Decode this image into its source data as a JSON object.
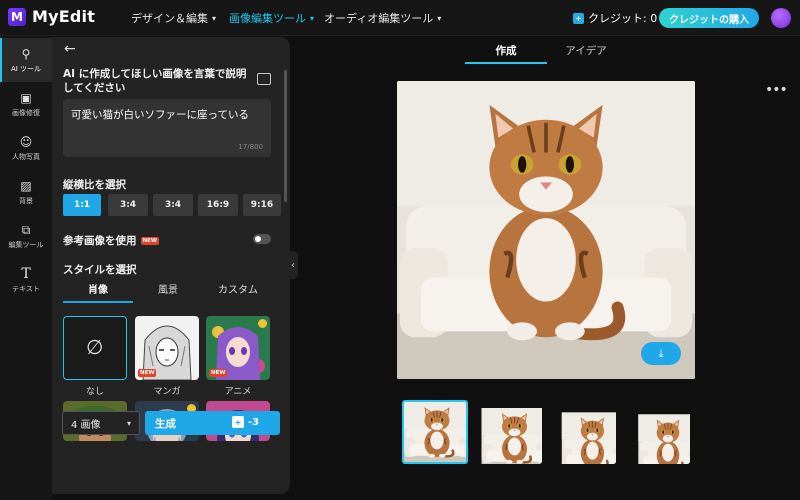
{
  "app": {
    "name": "MyEdit",
    "logo_letter": "M"
  },
  "topnav": [
    {
      "label": "デザイン＆編集",
      "active": false
    },
    {
      "label": "画像編集ツール",
      "active": true
    },
    {
      "label": "オーディオ編集ツール",
      "active": false
    }
  ],
  "credits": {
    "label": "クレジット: 0",
    "buy_label": "クレジットの購入"
  },
  "sidebar": {
    "items": [
      {
        "label": "AI ツール",
        "icon": "magic-wand-icon",
        "active": true
      },
      {
        "label": "画像修復",
        "icon": "image-icon",
        "active": false
      },
      {
        "label": "人物写真",
        "icon": "portrait-icon",
        "active": false
      },
      {
        "label": "背景",
        "icon": "background-icon",
        "active": false
      },
      {
        "label": "編集ツール",
        "icon": "layers-icon",
        "active": false
      },
      {
        "label": "テキスト",
        "icon": "text-icon",
        "active": false
      }
    ]
  },
  "panel": {
    "back_icon": "arrow-left-icon",
    "prompt_label": "AI に作成してほしい画像を言葉で説明してください",
    "prompt_icon": "image-add-icon",
    "prompt_value": "可愛い猫が白いソファーに座っている",
    "prompt_counter": "17/800",
    "ratio_label": "縦横比を選択",
    "ratios": [
      {
        "label": "1:1",
        "active": true
      },
      {
        "label": "3:4",
        "active": false
      },
      {
        "label": "3:4",
        "active": false
      },
      {
        "label": "16:9",
        "active": false
      },
      {
        "label": "9:16",
        "active": false
      }
    ],
    "reference_label": "参考画像を使用",
    "reference_badge": "NEW",
    "reference_enabled": false,
    "style_label": "スタイルを選択",
    "style_tabs": [
      {
        "label": "肖像",
        "active": true
      },
      {
        "label": "風景",
        "active": false
      },
      {
        "label": "カスタム",
        "active": false
      }
    ],
    "styles": [
      {
        "label": "なし",
        "selected": true,
        "badge": ""
      },
      {
        "label": "マンガ",
        "selected": false,
        "badge": "NEW"
      },
      {
        "label": "アニメ",
        "selected": false,
        "badge": "NEW"
      }
    ],
    "count_value": "4 画像",
    "generate_label": "生成",
    "generate_cost": "-3"
  },
  "canvas": {
    "tabs": [
      {
        "label": "作成",
        "active": true
      },
      {
        "label": "アイデア",
        "active": false
      }
    ],
    "more_icon": "more-horizontal-icon",
    "download_icon": "download-icon",
    "results_count": 4,
    "selected_result": 1
  },
  "colors": {
    "accent": "#1fa7e8",
    "accent_bright": "#22c7f0",
    "badge_red": "#e0442b",
    "panel": "#232323",
    "background": "#101010"
  }
}
